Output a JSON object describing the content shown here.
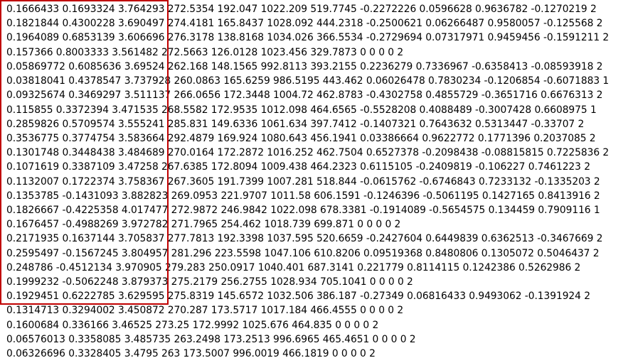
{
  "document": {
    "lines": [
      "0.1666433 0.1693324 3.764293 272.5354 192.047 1022.209 519.7745 -0.2272226 0.0596628 0.9636782 -0.1270219 2",
      "0.1821844 0.4300228 3.690497 274.4181 165.8437 1028.092 444.2318 -0.2500621 0.06266487 0.9580057 -0.125568 2",
      "0.1964089 0.6853139 3.606696 276.3178 138.8168 1034.026 366.5534 -0.2729694 0.07317971 0.9459456 -0.1591211 2",
      "0.157366 0.8003333 3.561482 272.5663 126.0128 1023.456 329.7873 0 0 0 0 2",
      "0.05869772 0.6085636 3.69524 262.168 148.1565 992.8113 393.2155 0.2236279 0.7336967 -0.6358413 -0.08593918 2",
      "0.03818041 0.4378547 3.737928 260.0863 165.6259 986.5195 443.462 0.06026478 0.7830234 -0.1206854 -0.6071883 1",
      "0.09325674 0.3469297 3.511137 266.0656 172.3448 1004.72 462.8783 -0.4302758 0.4855729 -0.3651716 0.6676313 2",
      "0.115855 0.3372394 3.471535 268.5582 172.9535 1012.098 464.6565 -0.5528208 0.4088489 -0.3007428 0.6608975 1",
      "0.2859826 0.5709574 3.555241 285.831 149.6336 1061.634 397.7412 -0.1407321 0.7643632 0.5313447 -0.33707 2",
      "0.3536775 0.3774754 3.583664 292.4879 169.924 1080.643 456.1941 0.03386664 0.9622772 0.1771396 0.2037085 2",
      "0.1301748 0.3448438 3.484689 270.0164 172.2872 1016.252 462.7504 0.6527378 -0.2098438 -0.08815815 0.7225836 2",
      "0.1071619 0.3387109 3.47258 267.6385 172.8094 1009.438 464.2323 0.6115105 -0.2409819 -0.106227 0.7461223 2",
      "0.1132007 0.1722374 3.758367 267.3605 191.7399 1007.281 518.844 -0.0615762 -0.6746843 0.7233132 -0.1335203 2",
      "0.1353785 -0.1431093 3.882823 269.0953 221.9707 1011.58 606.1591 -0.1246396 -0.5061195 0.1427165 0.8413916 2",
      "0.1826667 -0.4225358 4.017477 272.9872 246.9842 1022.098 678.3381 -0.1914089 -0.5654575 0.134459 0.7909116 1",
      "0.1676457 -0.4988269 3.972782 271.7965 254.462 1018.739 699.871 0 0 0 0 2",
      "0.2171935 0.1637144 3.705837 277.7813 192.3398 1037.595 520.6659 -0.2427604 0.6449839 0.6362513 -0.3467669 2",
      "0.2595497 -0.1567245 3.804957 281.296 223.5598 1047.106 610.8206 0.09519368 0.8480806 0.1305072 0.5046437 2",
      "0.248786 -0.4512134 3.970905 279.283 250.0917 1040.401 687.3141 0.221779 0.8114115 0.1242386 0.5262986 2",
      "0.1999232 -0.5062248 3.879373 275.2179 256.2755 1028.934 705.1041 0 0 0 0 2",
      "0.1929451 0.6222785 3.629595 275.8319 145.6572 1032.506 386.187 -0.27349 0.06816433 0.9493062 -0.1391924 2",
      "0.1314713 0.3294002 3.450872 270.287 173.5717 1017.184 466.4555 0 0 0 0 2",
      "0.1600684 0.336166 3.46525 273.25 172.9992 1025.676 464.835 0 0 0 0 2",
      "0.06576013 0.3358085 3.485735 263.2498 173.2513 996.6965 465.4651 0 0 0 0 2",
      "0.06326696 0.3328405 3.4795 263 173.5007 996.0019 466.1819 0 0 0 0 2"
    ]
  },
  "colors": {
    "text": "#000000",
    "background": "#ffffff",
    "selection_border": "#c00000"
  }
}
